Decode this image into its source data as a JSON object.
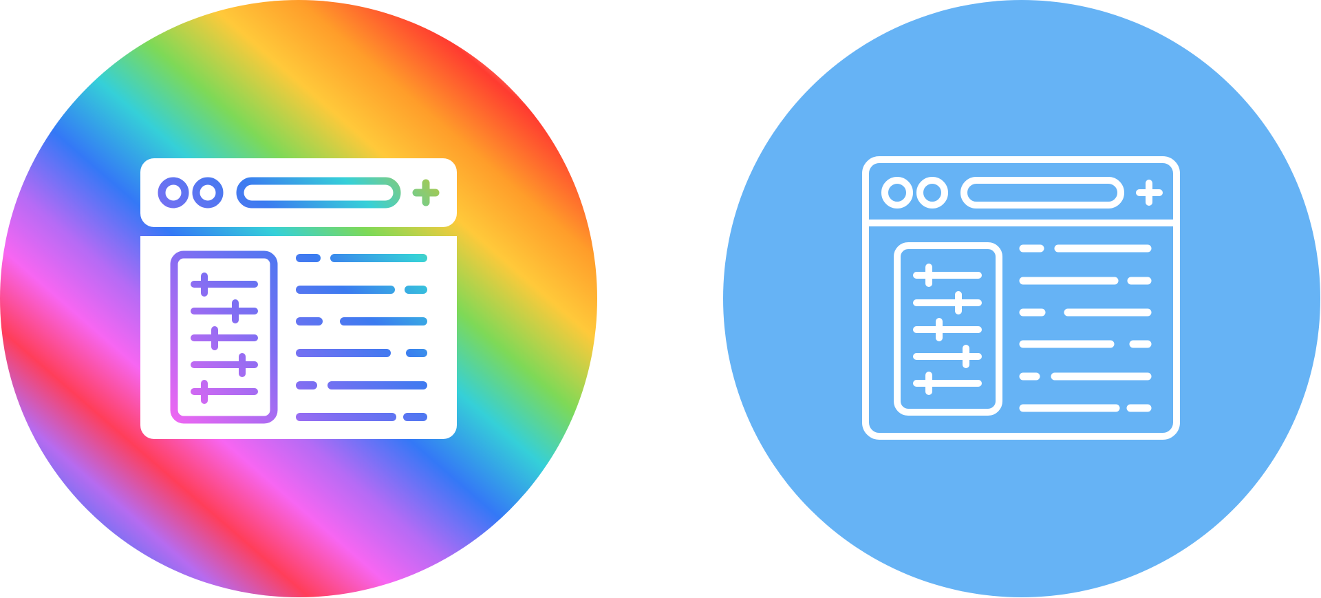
{
  "variants": [
    {
      "style": "gradient-filled",
      "icon": "browser-settings-icon",
      "background": "rainbow-gradient-circle",
      "colors": {
        "rainbow": [
          "#ff3b30",
          "#ff9500",
          "#ffcc33",
          "#7ed957",
          "#35d0d8",
          "#3478f6",
          "#b56bf5",
          "#f766f2",
          "#ff3e5a"
        ],
        "icon_body": "#ffffff"
      }
    },
    {
      "style": "outline",
      "icon": "browser-settings-icon",
      "background": "flat-blue-circle",
      "colors": {
        "circle": "#66b3f5",
        "stroke": "#ffffff"
      }
    }
  ]
}
